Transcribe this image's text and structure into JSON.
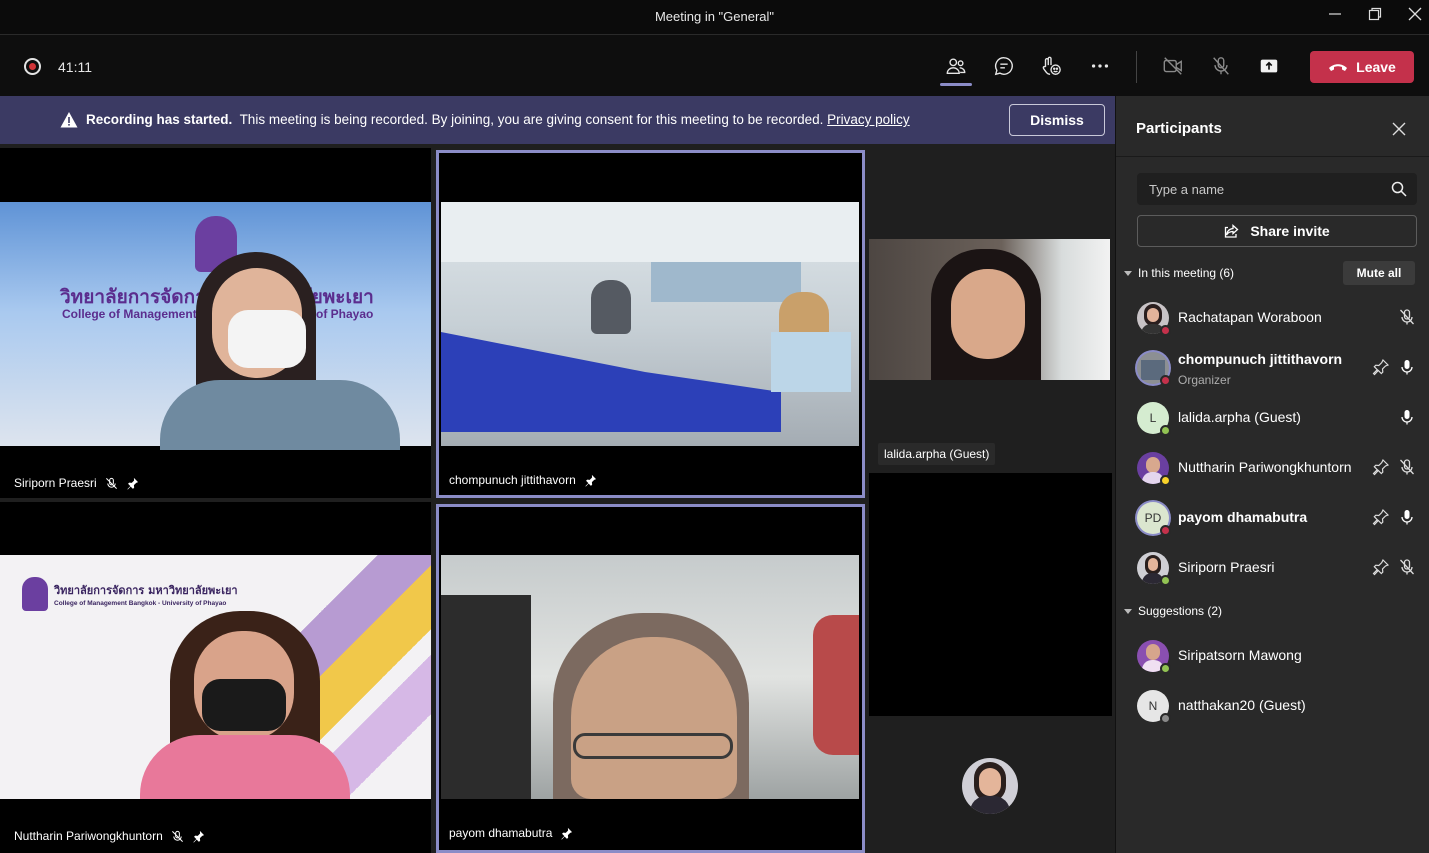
{
  "window": {
    "title": "Meeting in \"General\""
  },
  "toolbar": {
    "timer": "41:11",
    "icons": [
      "people-icon",
      "chat-icon",
      "reactions-icon",
      "more-icon",
      "camera-off-icon",
      "mic-off-icon",
      "share-tray-icon"
    ],
    "leave_label": "Leave"
  },
  "banner": {
    "bold": "Recording has started.",
    "text": "This meeting is being recorded. By joining, you are giving consent for this meeting to be recorded.",
    "link": "Privacy policy",
    "dismiss_label": "Dismiss"
  },
  "tiles": [
    {
      "name": "Siriporn Praesri"
    },
    {
      "name": "chompunuch jittithavorn"
    },
    {
      "name": "lalida.arpha (Guest)"
    },
    {
      "name": "Nuttharin Pariwongkhuntorn"
    },
    {
      "name": "payom dhamabutra"
    }
  ],
  "video_text": {
    "tile1_thai": "วิทยาลัยการจัดการ",
    "tile1_thai_right": "ลัยพะเยา",
    "tile1_eng": "College of Management B",
    "tile1_eng_right": "y of Phayao",
    "tile4_thai": "วิทยาลัยการจัดการ มหาวิทยาลัยพะเยา",
    "tile4_eng": "College of Management Bangkok - University of Phayao"
  },
  "panel": {
    "title": "Participants",
    "search_placeholder": "Type a name",
    "share_invite": "Share invite",
    "in_meeting": "In this meeting (6)",
    "mute_all": "Mute all",
    "participants": [
      {
        "name": "Rachatapan Woraboon",
        "role": "",
        "presence": "busy",
        "mic": "off",
        "pin": false
      },
      {
        "name": "chompunuch jittithavorn",
        "role": "Organizer",
        "presence": "busy",
        "mic": "on",
        "pin": true
      },
      {
        "name": "lalida.arpha (Guest)",
        "initial": "L",
        "presence": "available",
        "mic": "on",
        "pin": false
      },
      {
        "name": "Nuttharin Pariwongkhuntorn",
        "presence": "away",
        "mic": "off",
        "pin": true
      },
      {
        "name": "payom dhamabutra",
        "initial": "PD",
        "presence": "busy",
        "mic": "on",
        "pin": true
      },
      {
        "name": "Siriporn Praesri",
        "presence": "available",
        "mic": "off",
        "pin": true
      }
    ],
    "suggestions": "Suggestions (2)",
    "suggested": [
      {
        "name": "Siripatsorn Mawong",
        "presence": "available"
      },
      {
        "name": "natthakan20 (Guest)",
        "initial": "N",
        "presence": "offline"
      }
    ]
  },
  "colors": {
    "accent": "#8b8cc7",
    "leave": "#c4314b",
    "banner": "#3b3a63",
    "busy": "#c4314b",
    "available": "#92c353",
    "away": "#f8d22a"
  }
}
